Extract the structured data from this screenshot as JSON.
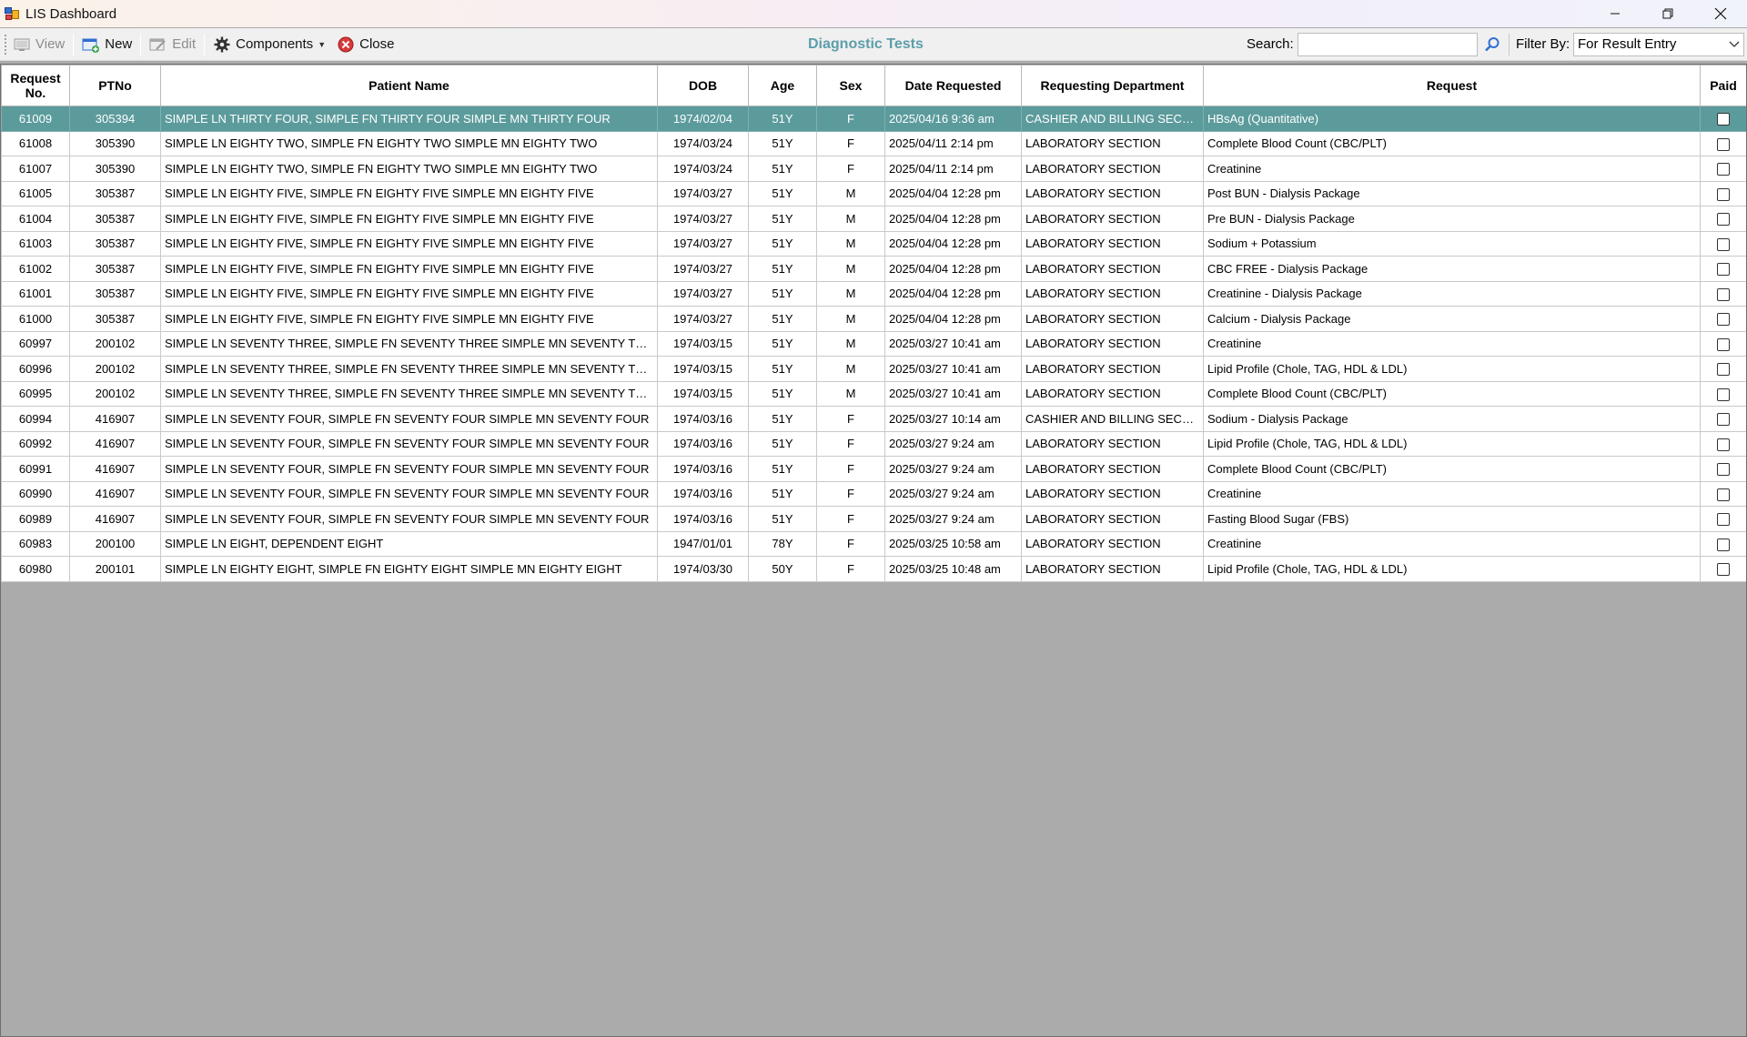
{
  "window": {
    "title": "LIS Dashboard"
  },
  "toolbar": {
    "view_label": "View",
    "new_label": "New",
    "edit_label": "Edit",
    "components_label": "Components",
    "close_label": "Close",
    "section_title": "Diagnostic Tests",
    "search_label": "Search:",
    "search_value": "",
    "filter_label": "Filter By:",
    "filter_value": "For Result Entry"
  },
  "grid": {
    "columns": {
      "request_no": "Request No.",
      "ptno": "PTNo",
      "patient_name": "Patient Name",
      "dob": "DOB",
      "age": "Age",
      "sex": "Sex",
      "date_requested": "Date Requested",
      "requesting_department": "Requesting Department",
      "request": "Request",
      "paid": "Paid"
    },
    "rows": [
      {
        "req": "61009",
        "ptno": "305394",
        "name": "SIMPLE LN THIRTY FOUR, SIMPLE FN THIRTY FOUR SIMPLE MN THIRTY FOUR",
        "dob": "1974/02/04",
        "age": "51Y",
        "sex": "F",
        "date": "2025/04/16 9:36 am",
        "dept": "CASHIER AND BILLING SECTI...",
        "request": "HBsAg (Quantitative)",
        "paid": false,
        "selected": true
      },
      {
        "req": "61008",
        "ptno": "305390",
        "name": "SIMPLE LN EIGHTY TWO, SIMPLE FN EIGHTY TWO SIMPLE MN EIGHTY TWO",
        "dob": "1974/03/24",
        "age": "51Y",
        "sex": "F",
        "date": "2025/04/11 2:14 pm",
        "dept": "LABORATORY SECTION",
        "request": "Complete Blood Count (CBC/PLT)",
        "paid": false
      },
      {
        "req": "61007",
        "ptno": "305390",
        "name": "SIMPLE LN EIGHTY TWO, SIMPLE FN EIGHTY TWO SIMPLE MN EIGHTY TWO",
        "dob": "1974/03/24",
        "age": "51Y",
        "sex": "F",
        "date": "2025/04/11 2:14 pm",
        "dept": "LABORATORY SECTION",
        "request": "Creatinine",
        "paid": false
      },
      {
        "req": "61005",
        "ptno": "305387",
        "name": "SIMPLE LN EIGHTY FIVE, SIMPLE FN EIGHTY FIVE SIMPLE MN EIGHTY FIVE",
        "dob": "1974/03/27",
        "age": "51Y",
        "sex": "M",
        "date": "2025/04/04 12:28 pm",
        "dept": "LABORATORY SECTION",
        "request": "Post BUN - Dialysis Package",
        "paid": false
      },
      {
        "req": "61004",
        "ptno": "305387",
        "name": "SIMPLE LN EIGHTY FIVE, SIMPLE FN EIGHTY FIVE SIMPLE MN EIGHTY FIVE",
        "dob": "1974/03/27",
        "age": "51Y",
        "sex": "M",
        "date": "2025/04/04 12:28 pm",
        "dept": "LABORATORY SECTION",
        "request": "Pre BUN - Dialysis Package",
        "paid": false
      },
      {
        "req": "61003",
        "ptno": "305387",
        "name": "SIMPLE LN EIGHTY FIVE, SIMPLE FN EIGHTY FIVE SIMPLE MN EIGHTY FIVE",
        "dob": "1974/03/27",
        "age": "51Y",
        "sex": "M",
        "date": "2025/04/04 12:28 pm",
        "dept": "LABORATORY SECTION",
        "request": "Sodium + Potassium",
        "paid": false
      },
      {
        "req": "61002",
        "ptno": "305387",
        "name": "SIMPLE LN EIGHTY FIVE, SIMPLE FN EIGHTY FIVE SIMPLE MN EIGHTY FIVE",
        "dob": "1974/03/27",
        "age": "51Y",
        "sex": "M",
        "date": "2025/04/04 12:28 pm",
        "dept": "LABORATORY SECTION",
        "request": "CBC FREE - Dialysis Package",
        "paid": false
      },
      {
        "req": "61001",
        "ptno": "305387",
        "name": "SIMPLE LN EIGHTY FIVE, SIMPLE FN EIGHTY FIVE SIMPLE MN EIGHTY FIVE",
        "dob": "1974/03/27",
        "age": "51Y",
        "sex": "M",
        "date": "2025/04/04 12:28 pm",
        "dept": "LABORATORY SECTION",
        "request": "Creatinine - Dialysis Package",
        "paid": false
      },
      {
        "req": "61000",
        "ptno": "305387",
        "name": "SIMPLE LN EIGHTY FIVE, SIMPLE FN EIGHTY FIVE SIMPLE MN EIGHTY FIVE",
        "dob": "1974/03/27",
        "age": "51Y",
        "sex": "M",
        "date": "2025/04/04 12:28 pm",
        "dept": "LABORATORY SECTION",
        "request": "Calcium - Dialysis Package",
        "paid": false
      },
      {
        "req": "60997",
        "ptno": "200102",
        "name": "SIMPLE LN SEVENTY THREE, SIMPLE FN SEVENTY THREE SIMPLE MN SEVENTY THREE",
        "dob": "1974/03/15",
        "age": "51Y",
        "sex": "M",
        "date": "2025/03/27 10:41 am",
        "dept": "LABORATORY SECTION",
        "request": "Creatinine",
        "paid": false
      },
      {
        "req": "60996",
        "ptno": "200102",
        "name": "SIMPLE LN SEVENTY THREE, SIMPLE FN SEVENTY THREE SIMPLE MN SEVENTY THREE",
        "dob": "1974/03/15",
        "age": "51Y",
        "sex": "M",
        "date": "2025/03/27 10:41 am",
        "dept": "LABORATORY SECTION",
        "request": "Lipid Profile (Chole, TAG, HDL & LDL)",
        "paid": false
      },
      {
        "req": "60995",
        "ptno": "200102",
        "name": "SIMPLE LN SEVENTY THREE, SIMPLE FN SEVENTY THREE SIMPLE MN SEVENTY THREE",
        "dob": "1974/03/15",
        "age": "51Y",
        "sex": "M",
        "date": "2025/03/27 10:41 am",
        "dept": "LABORATORY SECTION",
        "request": "Complete Blood Count (CBC/PLT)",
        "paid": false
      },
      {
        "req": "60994",
        "ptno": "416907",
        "name": "SIMPLE LN SEVENTY FOUR, SIMPLE FN SEVENTY FOUR SIMPLE MN SEVENTY FOUR",
        "dob": "1974/03/16",
        "age": "51Y",
        "sex": "F",
        "date": "2025/03/27 10:14 am",
        "dept": "CASHIER AND BILLING SECTI...",
        "request": "Sodium - Dialysis Package",
        "paid": false
      },
      {
        "req": "60992",
        "ptno": "416907",
        "name": "SIMPLE LN SEVENTY FOUR, SIMPLE FN SEVENTY FOUR SIMPLE MN SEVENTY FOUR",
        "dob": "1974/03/16",
        "age": "51Y",
        "sex": "F",
        "date": "2025/03/27 9:24 am",
        "dept": "LABORATORY SECTION",
        "request": "Lipid Profile (Chole, TAG, HDL & LDL)",
        "paid": false
      },
      {
        "req": "60991",
        "ptno": "416907",
        "name": "SIMPLE LN SEVENTY FOUR, SIMPLE FN SEVENTY FOUR SIMPLE MN SEVENTY FOUR",
        "dob": "1974/03/16",
        "age": "51Y",
        "sex": "F",
        "date": "2025/03/27 9:24 am",
        "dept": "LABORATORY SECTION",
        "request": "Complete Blood Count (CBC/PLT)",
        "paid": false
      },
      {
        "req": "60990",
        "ptno": "416907",
        "name": "SIMPLE LN SEVENTY FOUR, SIMPLE FN SEVENTY FOUR SIMPLE MN SEVENTY FOUR",
        "dob": "1974/03/16",
        "age": "51Y",
        "sex": "F",
        "date": "2025/03/27 9:24 am",
        "dept": "LABORATORY SECTION",
        "request": "Creatinine",
        "paid": false
      },
      {
        "req": "60989",
        "ptno": "416907",
        "name": "SIMPLE LN SEVENTY FOUR, SIMPLE FN SEVENTY FOUR SIMPLE MN SEVENTY FOUR",
        "dob": "1974/03/16",
        "age": "51Y",
        "sex": "F",
        "date": "2025/03/27 9:24 am",
        "dept": "LABORATORY SECTION",
        "request": "Fasting Blood Sugar (FBS)",
        "paid": false
      },
      {
        "req": "60983",
        "ptno": "200100",
        "name": "SIMPLE LN EIGHT, DEPENDENT EIGHT",
        "dob": "1947/01/01",
        "age": "78Y",
        "sex": "F",
        "date": "2025/03/25 10:58 am",
        "dept": "LABORATORY SECTION",
        "request": "Creatinine",
        "paid": false
      },
      {
        "req": "60980",
        "ptno": "200101",
        "name": "SIMPLE LN EIGHTY EIGHT, SIMPLE FN EIGHTY EIGHT SIMPLE MN EIGHTY EIGHT",
        "dob": "1974/03/30",
        "age": "50Y",
        "sex": "F",
        "date": "2025/03/25 10:48 am",
        "dept": "LABORATORY SECTION",
        "request": "Lipid Profile (Chole, TAG, HDL & LDL)",
        "paid": false
      }
    ]
  },
  "colors": {
    "selected_row": "#5c9b9c",
    "section_title": "#5c9eaa",
    "empty_area": "#ababab"
  }
}
